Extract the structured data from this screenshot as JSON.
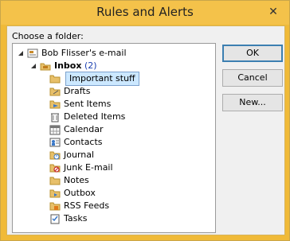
{
  "window": {
    "title": "Rules and Alerts",
    "close_glyph": "✕"
  },
  "folder_label": "Choose a folder:",
  "tree": {
    "root": "Bob Flisser's e-mail",
    "inbox": {
      "label": "Inbox",
      "count": "(2)"
    },
    "selected": "Important stuff",
    "folders": [
      {
        "label": "Drafts",
        "icon": "drafts-icon"
      },
      {
        "label": "Sent Items",
        "icon": "sent-items-icon"
      },
      {
        "label": "Deleted Items",
        "icon": "trash-icon"
      },
      {
        "label": "Calendar",
        "icon": "calendar-icon"
      },
      {
        "label": "Contacts",
        "icon": "contacts-icon"
      },
      {
        "label": "Journal",
        "icon": "journal-icon"
      },
      {
        "label": "Junk E-mail",
        "icon": "junk-icon"
      },
      {
        "label": "Notes",
        "icon": "notes-icon"
      },
      {
        "label": "Outbox",
        "icon": "outbox-icon"
      },
      {
        "label": "RSS Feeds",
        "icon": "rss-icon"
      },
      {
        "label": "Tasks",
        "icon": "tasks-icon"
      }
    ]
  },
  "buttons": {
    "ok": "OK",
    "cancel": "Cancel",
    "new": "New..."
  },
  "colors": {
    "frame": "#f0ba38",
    "selection": "#cce8ff",
    "folder": "#e8c06a",
    "count": "#1a3fb0"
  }
}
